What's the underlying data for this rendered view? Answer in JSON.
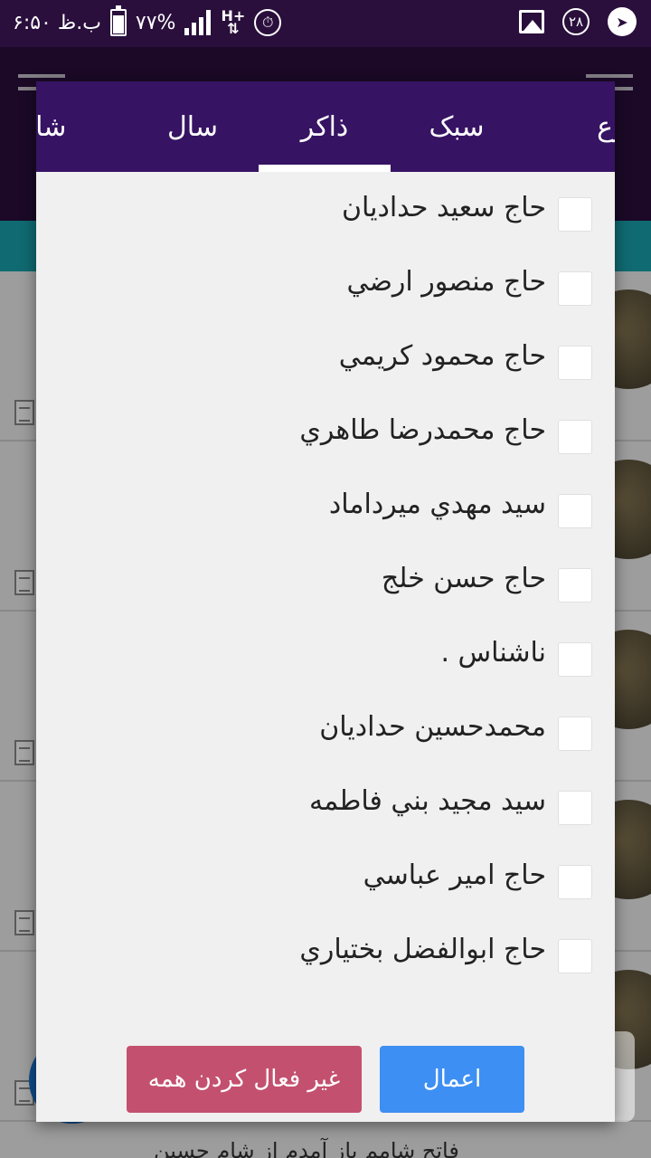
{
  "status_bar": {
    "time": "۶:۵۰ ب.ظ",
    "battery": "۷۷%",
    "battery_level": 0.77,
    "network": "H+",
    "notification_count": "۲۸"
  },
  "background": {
    "bottom_snippet": "فاتح شامم باز آمدم از شام حسین"
  },
  "dialog": {
    "tabs": [
      {
        "label": "نوع"
      },
      {
        "label": "سبک"
      },
      {
        "label": "ذاکر"
      },
      {
        "label": "سال"
      },
      {
        "label": "شاعر"
      }
    ],
    "active_tab": "ذاکر",
    "items": [
      {
        "label": "حاج سعيد حداديان",
        "checked": false
      },
      {
        "label": "حاج منصور ارضي",
        "checked": false
      },
      {
        "label": "حاج محمود كريمي",
        "checked": false
      },
      {
        "label": "حاج محمدرضا طاهري",
        "checked": false
      },
      {
        "label": "سيد مهدي ميرداماد",
        "checked": false
      },
      {
        "label": "حاج حسن خلج",
        "checked": false
      },
      {
        "label": "ناشناس .",
        "checked": false
      },
      {
        "label": "محمدحسين حداديان",
        "checked": false
      },
      {
        "label": "سيد مجيد بني فاطمه",
        "checked": false
      },
      {
        "label": "حاج امير عباسي",
        "checked": false
      },
      {
        "label": "حاج ابوالفضل بختياري",
        "checked": false
      }
    ],
    "apply_label": "اعمال",
    "deselect_all_label": "غير فعال کردن همه"
  },
  "colors": {
    "primary_dark": "#2a0f3c",
    "tab_bar": "#361363",
    "accent_teal": "#1aa3b0",
    "apply_button": "#3d8ff3",
    "deselect_button": "#c4506f"
  }
}
